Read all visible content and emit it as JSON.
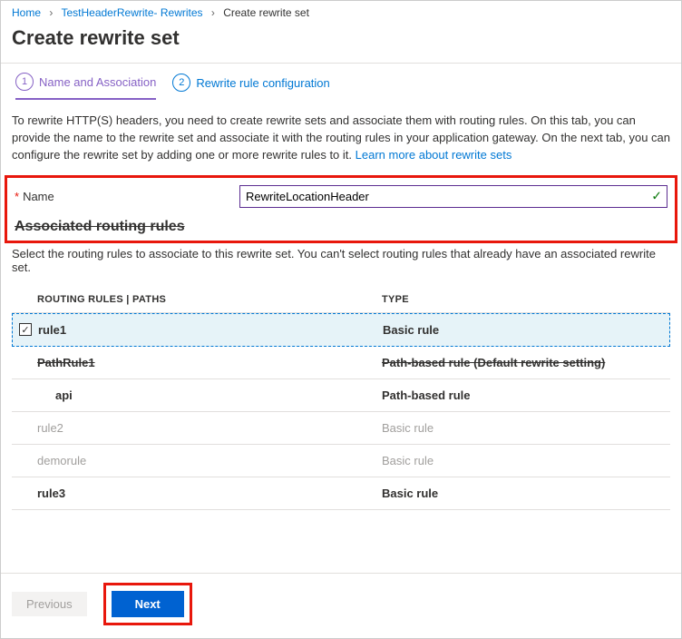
{
  "breadcrumb": {
    "items": [
      "Home",
      "TestHeaderRewrite- Rewrites"
    ],
    "current": "Create rewrite set"
  },
  "page_title": "Create rewrite set",
  "steps": {
    "one_num": "1",
    "one_label": "Name and Association",
    "two_num": "2",
    "two_label": "Rewrite rule configuration"
  },
  "description": "To rewrite HTTP(S) headers, you need to create rewrite sets and associate them with routing rules. On this tab, you can provide the name to the rewrite set and associate it with the routing rules in your application gateway. On the next tab, you can configure the rewrite set by adding one or more rewrite rules to it. ",
  "learn_more": "Learn more about rewrite sets",
  "name_label": "Name",
  "name_value": "RewriteLocationHeader",
  "assoc_heading": "Associated routing rules",
  "assoc_desc": "Select the routing rules to associate to this rewrite set. You can't select routing rules that already have an associated rewrite set.",
  "table": {
    "head_name": "ROUTING RULES | PATHS",
    "head_type": "TYPE",
    "rows": [
      {
        "name": "rule1",
        "type": "Basic rule",
        "checked": true,
        "selected": true,
        "disabled": false,
        "indent": false,
        "strike": false
      },
      {
        "name": "PathRule1",
        "type": "Path-based rule (Default rewrite setting)",
        "checked": false,
        "selected": false,
        "disabled": false,
        "indent": false,
        "strike": true
      },
      {
        "name": "api",
        "type": "Path-based rule",
        "checked": false,
        "selected": false,
        "disabled": false,
        "indent": true,
        "strike": false
      },
      {
        "name": "rule2",
        "type": "Basic rule",
        "checked": false,
        "selected": false,
        "disabled": true,
        "indent": false,
        "strike": false
      },
      {
        "name": "demorule",
        "type": "Basic rule",
        "checked": false,
        "selected": false,
        "disabled": true,
        "indent": false,
        "strike": false
      },
      {
        "name": "rule3",
        "type": "Basic rule",
        "checked": false,
        "selected": false,
        "disabled": false,
        "indent": false,
        "strike": false
      }
    ]
  },
  "footer": {
    "prev": "Previous",
    "next": "Next"
  }
}
